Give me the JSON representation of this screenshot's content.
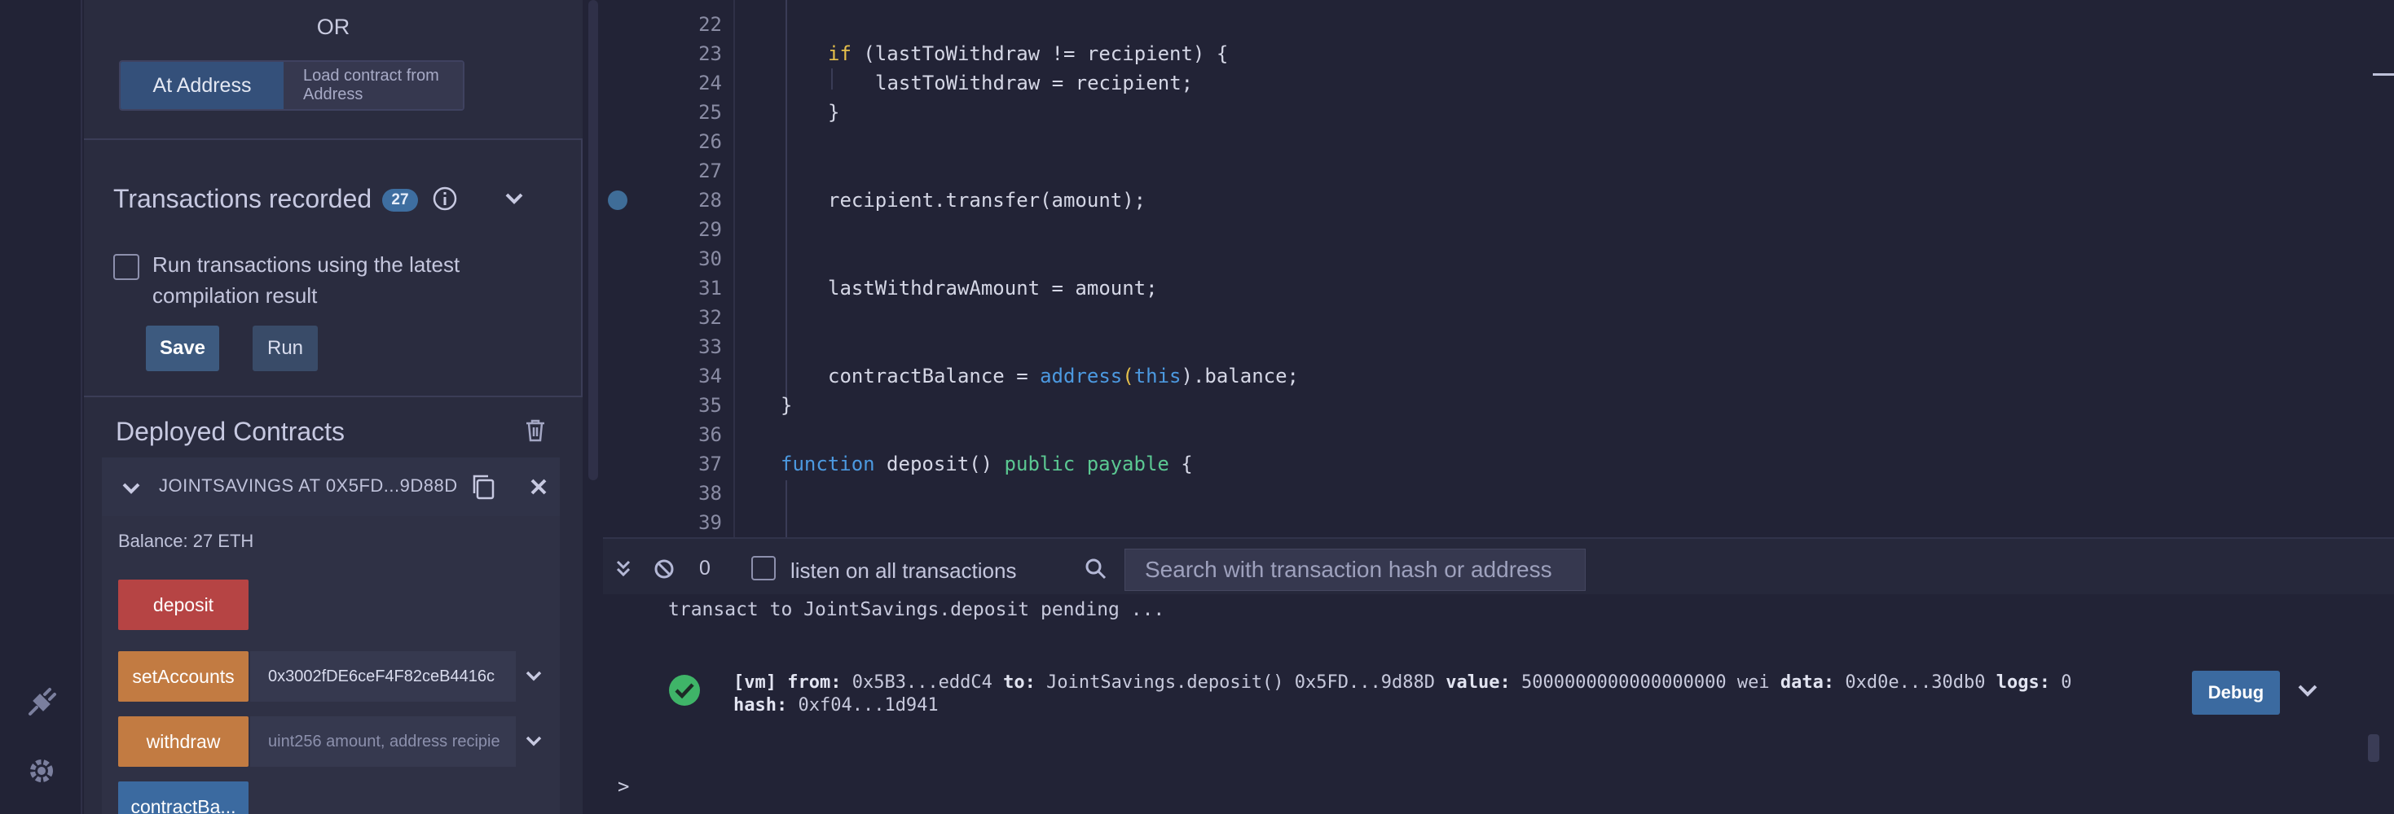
{
  "side_panel": {
    "or_label": "OR",
    "at_address_button": "At Address",
    "load_contract_placeholder": "Load contract from Address",
    "recorder": {
      "title": "Transactions recorded",
      "count": "27",
      "checkbox_label": "Run transactions using the latest compilation result",
      "save_label": "Save",
      "run_label": "Run"
    },
    "deployed": {
      "title": "Deployed Contracts",
      "instance_name": "JOINTSAVINGS AT 0X5FD...9D88D",
      "balance": "Balance: 27 ETH",
      "functions": [
        {
          "label": "deposit",
          "kind": "payable",
          "color": "#b64444"
        },
        {
          "label": "setAccounts",
          "kind": "nonpayable",
          "color": "#c27b42",
          "input_value": "0x3002fDE6ceF4F82ceB4416c"
        },
        {
          "label": "withdraw",
          "kind": "nonpayable",
          "color": "#c27b42",
          "input_placeholder": "uint256 amount, address recipie"
        },
        {
          "label": "contractBa...",
          "kind": "view",
          "color": "#3b6aa0"
        }
      ]
    }
  },
  "editor": {
    "lines": [
      {
        "n": "22"
      },
      {
        "n": "23"
      },
      {
        "n": "24"
      },
      {
        "n": "25"
      },
      {
        "n": "26"
      },
      {
        "n": "27"
      },
      {
        "n": "28",
        "breakpoint": true
      },
      {
        "n": "29"
      },
      {
        "n": "30"
      },
      {
        "n": "31"
      },
      {
        "n": "32"
      },
      {
        "n": "33"
      },
      {
        "n": "34"
      },
      {
        "n": "35"
      },
      {
        "n": "36"
      },
      {
        "n": "37"
      },
      {
        "n": "38"
      },
      {
        "n": "39"
      }
    ],
    "code": {
      "l23_if": "if",
      "l23_rest": " (lastToWithdraw != recipient) {",
      "l24": "lastToWithdraw = recipient;",
      "l25": "}",
      "l28": "recipient.transfer(amount);",
      "l31": "lastWithdrawAmount = amount;",
      "l34_a": "contractBalance = ",
      "l34_addr": "address",
      "l34_paren": "(",
      "l34_this": "this",
      "l34_b": ").balance;",
      "l35": "}",
      "l37_fn": "function",
      "l37_name": " deposit() ",
      "l37_pub": "public",
      "l37_sp": " ",
      "l37_pay": "payable",
      "l37_brace": " {"
    }
  },
  "terminal": {
    "pending_count": "0",
    "listen_label": "listen on all transactions",
    "search_placeholder": "Search with transaction hash or address",
    "pending_line": "transact to JointSavings.deposit pending ...",
    "tx": {
      "vm": "[vm]",
      "from_label": "from:",
      "from": "0x5B3...eddC4",
      "to_label": "to:",
      "to": "JointSavings.deposit() 0x5FD...9d88D",
      "value_label": "value:",
      "value": "5000000000000000000 wei",
      "data_label": "data:",
      "data": "0xd0e...30db0",
      "logs_label": "logs:",
      "logs": "0",
      "hash_label": "hash:",
      "hash": "0xf04...1d941"
    },
    "debug_label": "Debug",
    "prompt": ">"
  },
  "colors": {
    "background": "#222336",
    "panel": "#2a2c3f",
    "accent_blue": "#3b6aa0",
    "payable_red": "#b64444",
    "transact_orange": "#c27b42",
    "success_green": "#3fb468"
  },
  "icons": [
    "plugin-icon",
    "gear-icon",
    "info-icon",
    "chevron-down-icon",
    "trash-icon",
    "copy-icon",
    "close-icon",
    "double-chevron-down-icon",
    "ban-icon",
    "search-icon",
    "check-circle-icon"
  ]
}
